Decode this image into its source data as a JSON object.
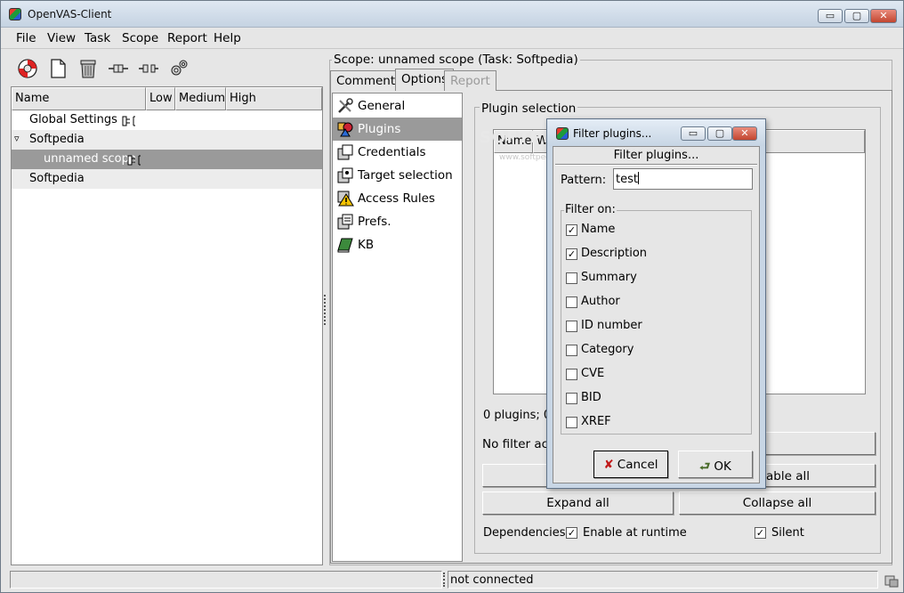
{
  "window": {
    "title": "OpenVAS-Client",
    "min": "▭",
    "max": "▢",
    "close": "✕"
  },
  "menu": [
    "File",
    "View",
    "Task",
    "Scope",
    "Report",
    "Help"
  ],
  "toolbar": [
    "lifebuoy-icon",
    "new-document-icon",
    "trash-icon",
    "connect-icon",
    "disconnect-icon",
    "settings-gears-icon"
  ],
  "tree": {
    "columns": [
      "Name",
      "Low",
      "Medium",
      "High"
    ],
    "rows": [
      {
        "label": "Global Settings",
        "indent": 0
      },
      {
        "label": "Softpedia",
        "indent": 0,
        "expander": "▿"
      },
      {
        "label": "unnamed scope",
        "indent": 1,
        "selected": true
      },
      {
        "label": "Softpedia",
        "indent": 0
      }
    ]
  },
  "scope": {
    "title": "Scope: unnamed scope (Task: Softpedia)",
    "tabs": [
      {
        "label": "Comments"
      },
      {
        "label": "Options",
        "active": true
      },
      {
        "label": "Report",
        "disabled": true
      }
    ],
    "categories": [
      "General",
      "Plugins",
      "Credentials",
      "Target selection",
      "Access Rules",
      "Prefs.",
      "KB"
    ],
    "plugin_selection": {
      "frame_label": "Plugin selection",
      "col_name": "Name",
      "col_w": "W",
      "count_text": "0 plugins; 0",
      "filter_text": "No filter activ",
      "enable_all_partial": "able all",
      "expand_all": "Expand all",
      "collapse_all": "Collapse all",
      "dependencies_label": "Dependencies:",
      "enable_runtime": "Enable at runtime",
      "silent": "Silent",
      "watermark_main": "SOFTPEDIA",
      "watermark_sub": "www.softpedia.com"
    }
  },
  "dialog": {
    "title": "Filter plugins...",
    "heading": "Filter plugins...",
    "pattern_label": "Pattern:",
    "pattern_value": "test",
    "filter_on_label": "Filter on:",
    "options": [
      {
        "label": "Name",
        "checked": true
      },
      {
        "label": "Description",
        "checked": true
      },
      {
        "label": "Summary",
        "checked": false
      },
      {
        "label": "Author",
        "checked": false
      },
      {
        "label": "ID number",
        "checked": false
      },
      {
        "label": "Category",
        "checked": false
      },
      {
        "label": "CVE",
        "checked": false
      },
      {
        "label": "BID",
        "checked": false
      },
      {
        "label": "XREF",
        "checked": false
      }
    ],
    "cancel_label": "Cancel",
    "ok_label": "OK"
  },
  "status": {
    "text": "not connected"
  },
  "check_mark": "✓"
}
